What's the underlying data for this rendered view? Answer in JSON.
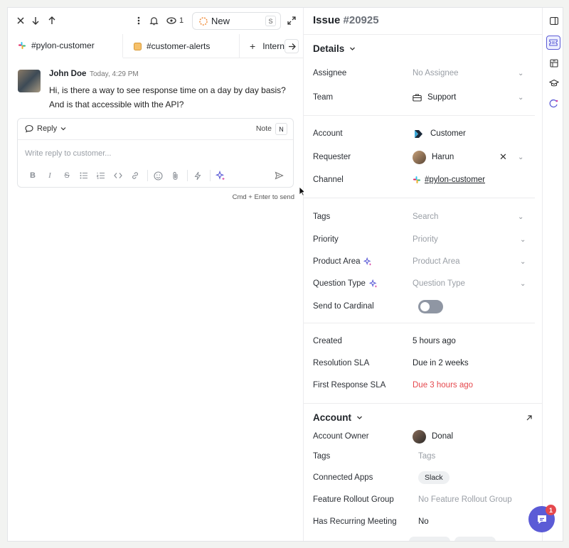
{
  "toolbar": {
    "watchers_count": "1",
    "status_label": "New",
    "status_shortcut": "S"
  },
  "tabs": [
    {
      "label": "#pylon-customer"
    },
    {
      "label": "#customer-alerts"
    },
    {
      "label": "Interna"
    }
  ],
  "message": {
    "author": "John Doe",
    "time": "Today, 4:29 PM",
    "text": "Hi, is there a way to see response time on a day by day basis? And is that accessible with the API?"
  },
  "reply": {
    "mode_label": "Reply",
    "note_label": "Note",
    "note_shortcut": "N",
    "placeholder": "Write reply to customer...",
    "send_hint": "Cmd + Enter to send"
  },
  "issue": {
    "title_prefix": "Issue",
    "number": "#20925"
  },
  "details": {
    "heading": "Details",
    "assignee_label": "Assignee",
    "assignee_value": "No Assignee",
    "team_label": "Team",
    "team_value": "Support",
    "account_label": "Account",
    "account_value": "Customer",
    "requester_label": "Requester",
    "requester_value": "Harun",
    "channel_label": "Channel",
    "channel_value": "#pylon-customer",
    "tags_label": "Tags",
    "tags_placeholder": "Search",
    "priority_label": "Priority",
    "priority_placeholder": "Priority",
    "product_area_label": "Product Area",
    "product_area_placeholder": "Product Area",
    "question_type_label": "Question Type",
    "question_type_placeholder": "Question Type",
    "send_to_cardinal_label": "Send to Cardinal",
    "send_to_cardinal_on": false,
    "created_label": "Created",
    "created_value": "5 hours ago",
    "resolution_sla_label": "Resolution SLA",
    "resolution_sla_value": "Due in 2 weeks",
    "first_response_sla_label": "First Response SLA",
    "first_response_sla_value": "Due 3 hours ago"
  },
  "account": {
    "heading": "Account",
    "owner_label": "Account Owner",
    "owner_value": "Donal",
    "tags_label": "Tags",
    "tags_placeholder": "Tags",
    "connected_apps_label": "Connected Apps",
    "connected_apps_value": "Slack",
    "feature_rollout_label": "Feature Rollout Group",
    "feature_rollout_value": "No Feature Rollout Group",
    "recurring_meeting_label": "Has Recurring Meeting",
    "recurring_meeting_value": "No"
  },
  "chat_widget": {
    "badge_count": "1"
  },
  "colors": {
    "accent": "#5b5bd6",
    "danger": "#e5484d",
    "toggle_off": "#8f96a3"
  }
}
